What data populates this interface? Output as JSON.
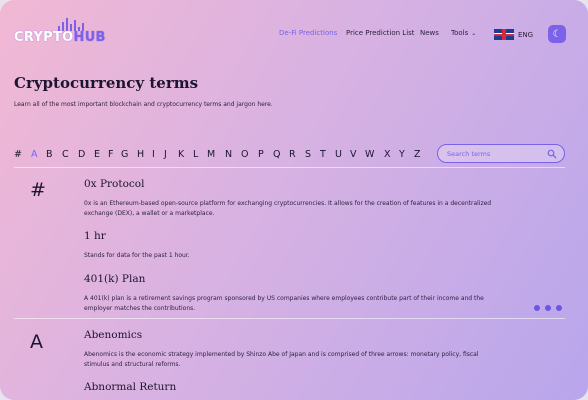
{
  "logo": {
    "part1": "CRYPTO",
    "part2": "HUB"
  },
  "nav": [
    {
      "label": "De-Fi Predictions"
    },
    {
      "label": "Price Prediction List"
    },
    {
      "label": "News"
    },
    {
      "label": "Tools"
    }
  ],
  "lang": {
    "label": "ENG"
  },
  "page": {
    "title": "Cryptocurrency terms",
    "subtitle": "Learn all of the most important blockchain and cryptocurrency terms and jargon here."
  },
  "alphabet": [
    "#",
    "A",
    "B",
    "C",
    "D",
    "E",
    "F",
    "G",
    "H",
    "I",
    "J",
    "K",
    "L",
    "M",
    "N",
    "O",
    "P",
    "Q",
    "R",
    "S",
    "T",
    "U",
    "V",
    "W",
    "X",
    "Y",
    "Z"
  ],
  "alphabet_active": "A",
  "search": {
    "placeholder": "Search terms"
  },
  "sections": [
    {
      "letter": "#",
      "terms": [
        {
          "name": "0x Protocol",
          "desc": "0x is an Ethereum-based open-source platform for exchanging cryptocurrencies. It allows for the creation of features in a decentralized exchange (DEX), a wallet or a marketplace."
        },
        {
          "name": "1 hr",
          "desc": "Stands for data for the past 1 hour."
        },
        {
          "name": "401(k) Plan",
          "desc": "A 401(k) plan is a retirement savings program sponsored by US companies where employees contribute part of their income and the employer matches the contributions."
        }
      ]
    },
    {
      "letter": "A",
      "terms": [
        {
          "name": "Abenomics",
          "desc": "Abenomics is the economic strategy implemented by Shinzo Abe of Japan and is comprised of three arrows: monetary policy, fiscal stimulus and structural reforms."
        },
        {
          "name": "Abnormal Return",
          "desc": ""
        }
      ]
    }
  ]
}
